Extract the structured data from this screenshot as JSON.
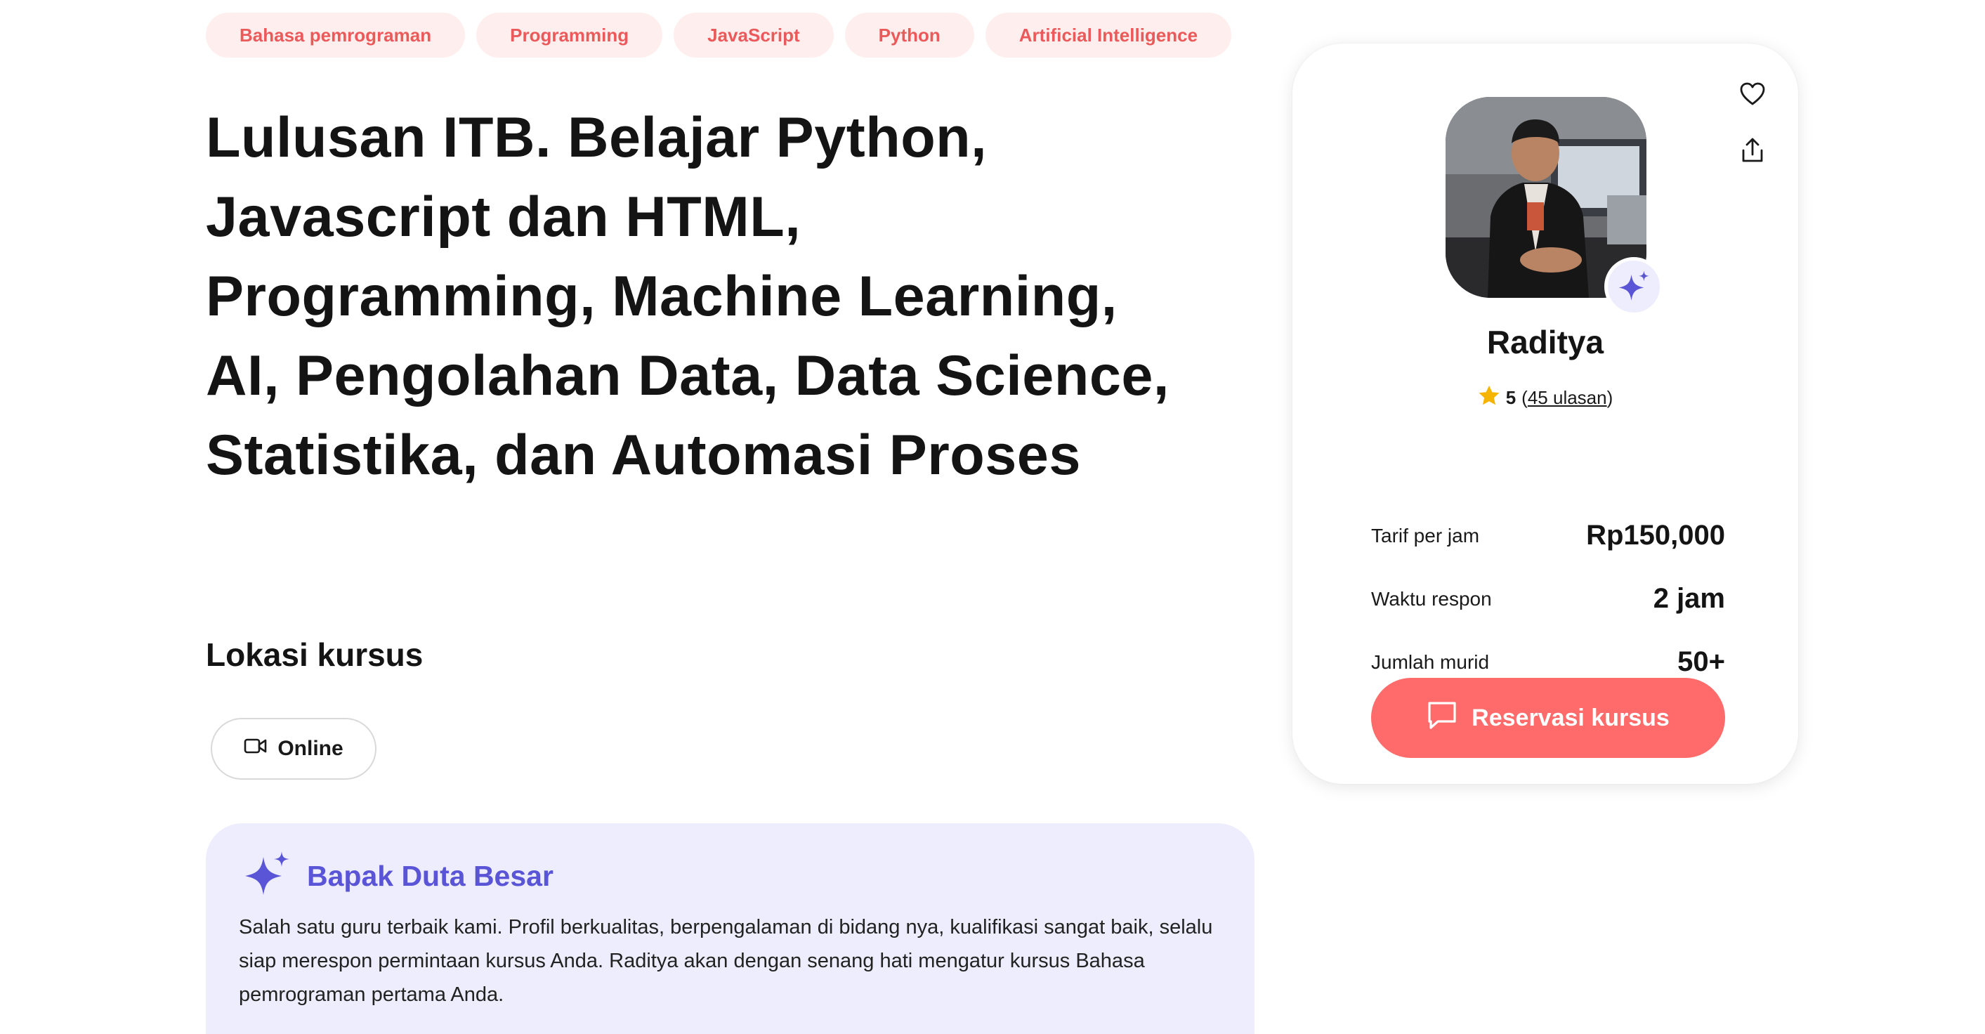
{
  "tags": [
    "Bahasa pemrograman",
    "Programming",
    "JavaScript",
    "Python",
    "Artificial Intelligence"
  ],
  "title": "Lulusan ITB. Belajar Python, Javascript dan HTML, Programming, Machine Learning, AI, Pengolahan Data, Data Science, Statistika, dan Automasi Proses",
  "location": {
    "heading": "Lokasi kursus",
    "option": "Online"
  },
  "highlight": {
    "title": "Bapak Duta Besar",
    "text": "Salah satu guru terbaik kami. Profil berkualitas, berpengalaman di bidang nya, kualifikasi sangat baik, selalu siap merespon permintaan kursus Anda. Raditya akan dengan senang hati mengatur kursus Bahasa pemrograman pertama Anda."
  },
  "tutor": {
    "name": "Raditya",
    "rating": "5",
    "reviews": "45 ulasan",
    "stats": [
      {
        "label": "Tarif per jam",
        "value": "Rp150,000"
      },
      {
        "label": "Waktu respon",
        "value": "2 jam"
      },
      {
        "label": "Jumlah murid",
        "value": "50+"
      }
    ],
    "cta": "Reservasi kursus"
  },
  "icons": {
    "favorite": "heart-icon",
    "share": "share-icon",
    "badge": "sparkle-icon",
    "star": "star-icon",
    "video": "video-camera-icon",
    "chat": "chat-bubble-icon"
  },
  "colors": {
    "accent": "#ff6a6a",
    "tag_bg": "#ffeeee",
    "tag_text": "#ea5a5a",
    "highlight_bg": "#eeedfd",
    "highlight_text": "#5a55d6",
    "star": "#f5b400"
  }
}
